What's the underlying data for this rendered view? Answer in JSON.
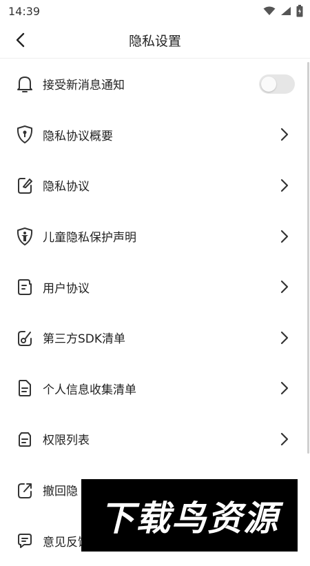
{
  "status_bar": {
    "time": "14:39",
    "icons": [
      "wifi-icon",
      "signal-icon",
      "battery-icon"
    ]
  },
  "header": {
    "title": "隐私设置",
    "back_icon": "back-arrow-icon"
  },
  "items": [
    {
      "label": "接受新消息通知",
      "icon": "bell-icon",
      "control": "toggle",
      "toggle_on": false
    },
    {
      "label": "隐私协议概要",
      "icon": "shield-keyhole-icon",
      "control": "chevron"
    },
    {
      "label": "隐私协议",
      "icon": "edit-note-icon",
      "control": "chevron"
    },
    {
      "label": "儿童隐私保护声明",
      "icon": "child-shield-icon",
      "control": "chevron"
    },
    {
      "label": "用户协议",
      "icon": "document-icon",
      "control": "chevron"
    },
    {
      "label": "第三方SDK清单",
      "icon": "edit-badge-icon",
      "control": "chevron"
    },
    {
      "label": "个人信息收集清单",
      "icon": "file-list-icon",
      "control": "chevron"
    },
    {
      "label": "权限列表",
      "icon": "permission-list-icon",
      "control": "chevron"
    },
    {
      "label": "撤回隐",
      "icon": "share-out-icon",
      "control": "chevron"
    },
    {
      "label": "意见反馈",
      "icon": "feedback-icon",
      "control": "chevron"
    }
  ],
  "watermark": {
    "text": "下载鸟资源"
  },
  "colors": {
    "toggle_off": "#e6e6e6",
    "text": "#222222",
    "icon": "#333333"
  }
}
